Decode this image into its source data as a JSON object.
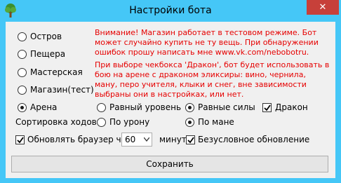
{
  "window": {
    "title": "Настройки бота",
    "close_glyph": "✕",
    "icon": "tree-icon"
  },
  "locations": [
    {
      "label": "Остров",
      "selected": false
    },
    {
      "label": "Пещера",
      "selected": false
    },
    {
      "label": "Мастерская",
      "selected": false
    },
    {
      "label": "Магазин(тест)",
      "selected": false
    },
    {
      "label": "Арена",
      "selected": true
    }
  ],
  "notices": {
    "warning": "Внимание! Магазин работает в тестовом режиме. Бот может случайно купить не ту вещь. При обнаружении ошибок прошу написать мне www.vk.com/nebobotru.",
    "dragon_info": "При выборе чекбокса 'Дракон', бот будет использовать в бою на арене с драконом эликсиры: вино, чернила, ману, перо учителя, клыки и снег, вне зависимости выбраны они в настройках, или нет."
  },
  "arena_mode": {
    "equal_level": {
      "label": "Равный уровень",
      "selected": false
    },
    "equal_strength": {
      "label": "Равные силы",
      "selected": true
    }
  },
  "dragon": {
    "label": "Дракон",
    "checked": true
  },
  "move_sort": {
    "label": "Сортировка ходов",
    "by_damage": {
      "label": "По урону",
      "selected": false
    },
    "by_mana": {
      "label": "По мане",
      "selected": true
    }
  },
  "refresh": {
    "label": "Обновлять браузер через",
    "checked": true,
    "value": "60",
    "unit": "минут.",
    "unconditional": {
      "label": "Безусловное обновление",
      "checked": true
    }
  },
  "save_label": "Сохранить",
  "colors": {
    "frame": "#45c7f7",
    "close": "#c7403a",
    "notice": "#e60000",
    "background": "#f0f0f0"
  }
}
